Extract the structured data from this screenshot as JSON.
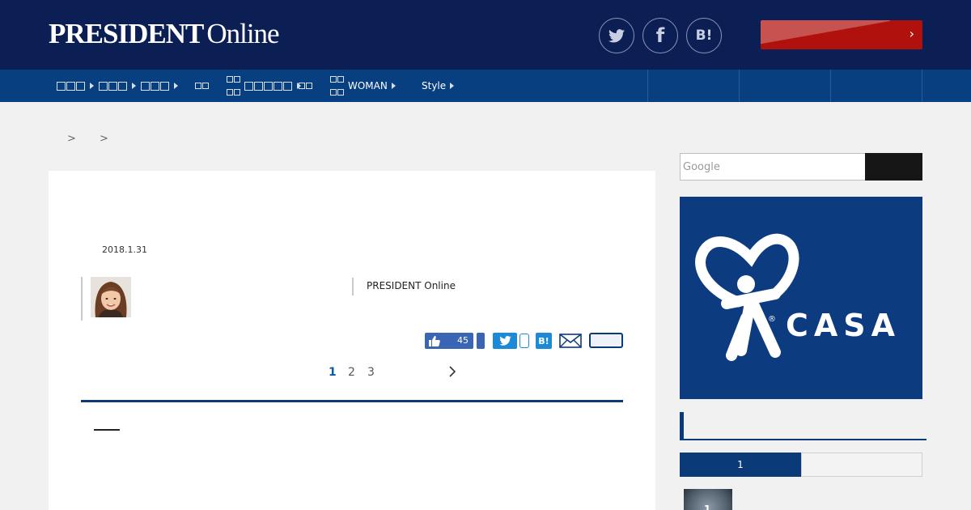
{
  "header": {
    "logo_bold": "PRESIDENT",
    "logo_regular": "Online",
    "social": {
      "twitter_icon": "twitter-icon",
      "facebook_label": "f",
      "hatena_label": "B!"
    },
    "cta_arrow": "›",
    "colors": {
      "header_bg": "#0b1f55",
      "nav_bg": "#083f80",
      "cta_bg": "#b0110d"
    }
  },
  "nav": {
    "woman_label": "WOMAN",
    "style_label": "Style"
  },
  "breadcrumb": {
    "sep1": ">",
    "sep2": ">"
  },
  "article": {
    "date": "2018.1.31",
    "source": "PRESIDENT Online",
    "like_count": "45",
    "hatena_label": "B!",
    "pages": [
      "1",
      "2",
      "3"
    ],
    "current_page": "1",
    "next_label": "›"
  },
  "sidebar": {
    "search_placeholder": "Google",
    "ad_text": "CASA",
    "ad_reg": "®",
    "tab_active_label": "1",
    "thumb_number": "1"
  }
}
